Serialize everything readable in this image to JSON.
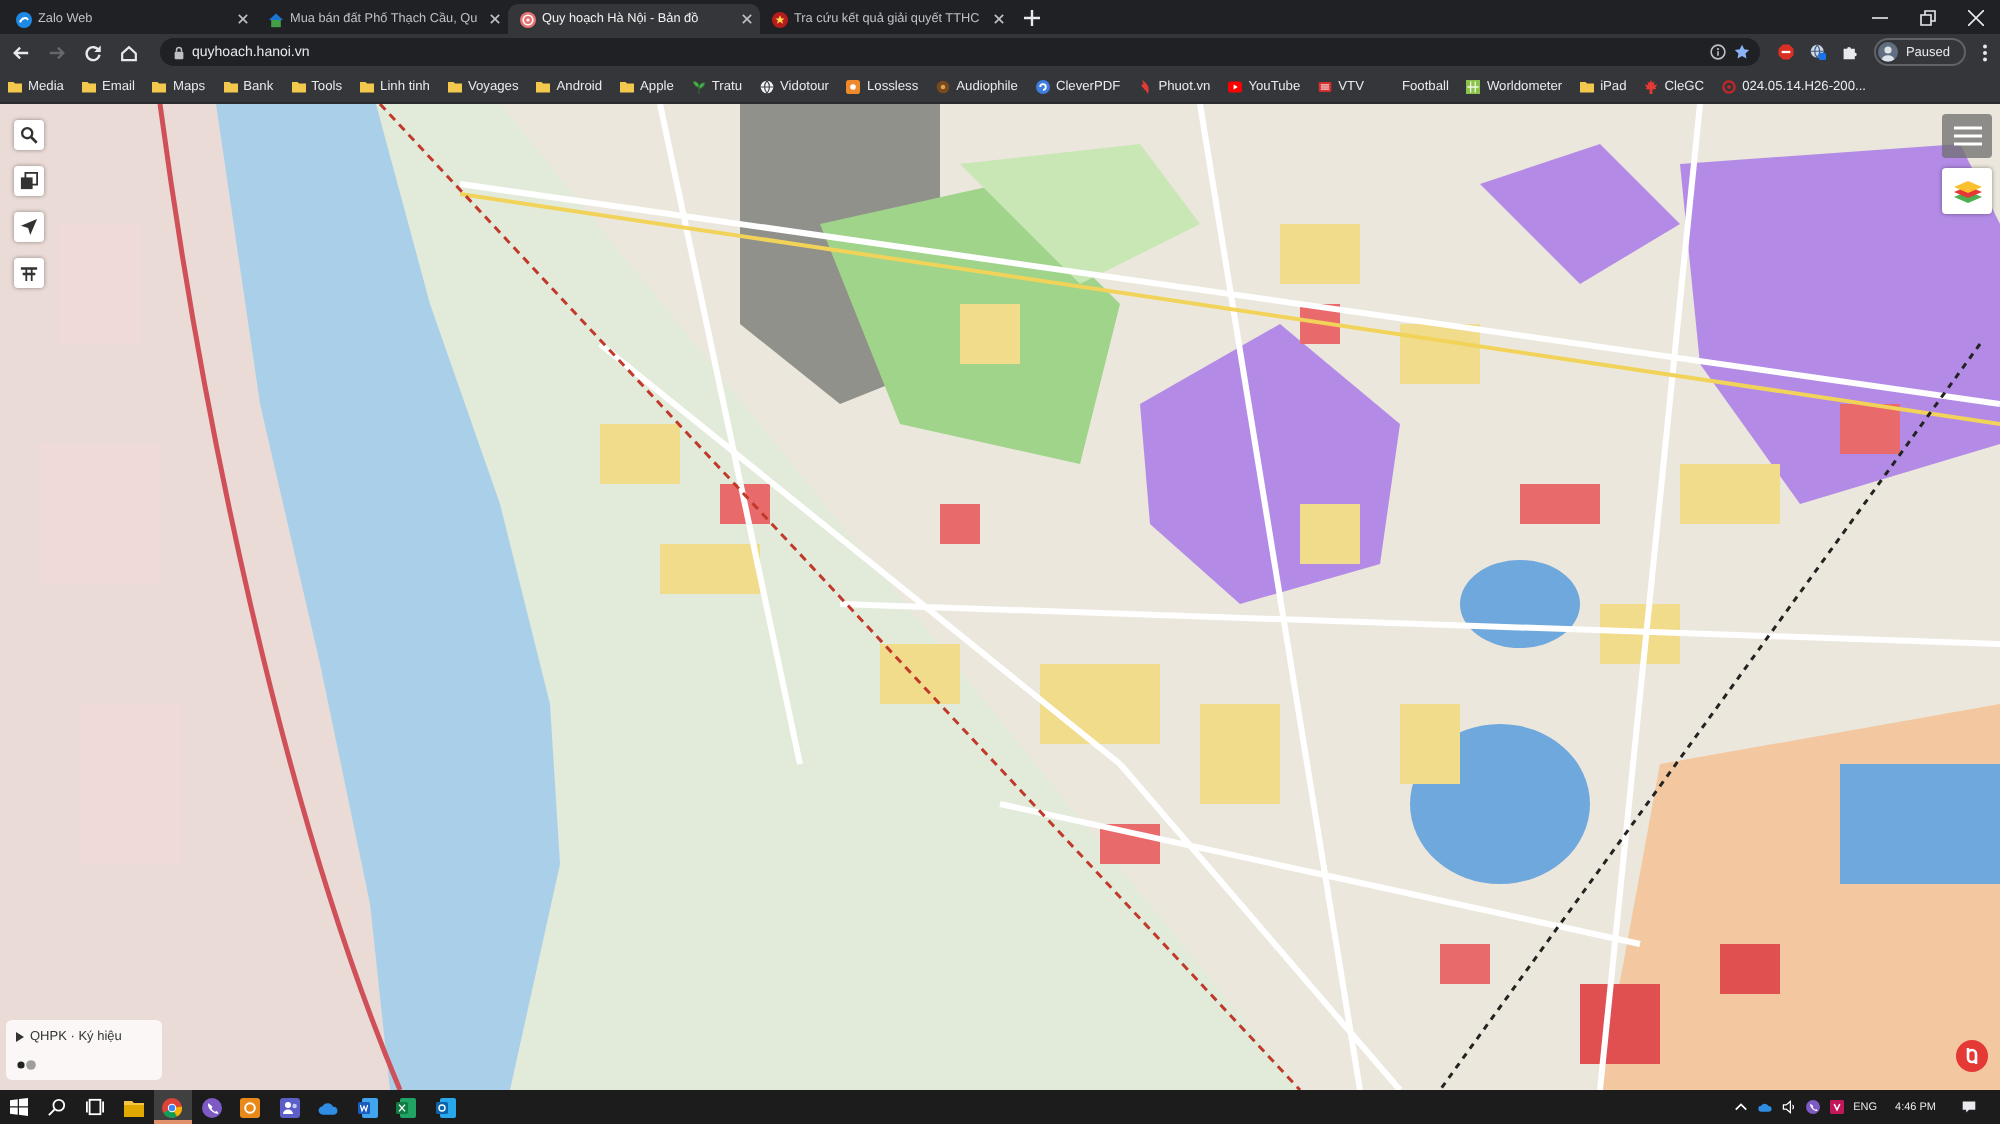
{
  "tabs": [
    {
      "title": "Zalo Web",
      "kind": "bubble",
      "selected": false
    },
    {
      "title": "Mua bán đất Phố Thạch Cầu, Qu",
      "kind": "house",
      "selected": false
    },
    {
      "title": "Quy hoạch Hà Nội - Bản đồ",
      "kind": "emblem",
      "selected": true
    },
    {
      "title": "Tra cứu kết quả giải quyết TTHC",
      "kind": "seal",
      "selected": false
    }
  ],
  "toolbar": {
    "forward": {
      "disabled": true
    },
    "url": "quyhoach.hanoi.vn",
    "profile": {
      "label": "Paused"
    }
  },
  "bookmarks": [
    {
      "label": "Media",
      "kind": "folder"
    },
    {
      "label": "Email",
      "kind": "folder"
    },
    {
      "label": "Maps",
      "kind": "folder"
    },
    {
      "label": "Bank",
      "kind": "folder"
    },
    {
      "label": "Tools",
      "kind": "folder"
    },
    {
      "label": "Linh tinh",
      "kind": "folder"
    },
    {
      "label": "Voyages",
      "kind": "folder"
    },
    {
      "label": "Android",
      "kind": "folder"
    },
    {
      "label": "Apple",
      "kind": "folder"
    },
    {
      "label": "Tratu",
      "kind": "plant"
    },
    {
      "label": "Vidotour",
      "kind": "globe"
    },
    {
      "label": "Lossless",
      "kind": "tile"
    },
    {
      "label": "Audiophile",
      "kind": "dot"
    },
    {
      "label": "CleverPDF",
      "kind": "swirl"
    },
    {
      "label": "Phuot.vn",
      "kind": "flame"
    },
    {
      "label": "YouTube",
      "kind": "play"
    },
    {
      "label": "VTV",
      "kind": "badge"
    },
    {
      "label": "Football",
      "kind": "blank"
    },
    {
      "label": "Worldometer",
      "kind": "grid"
    },
    {
      "label": "iPad",
      "kind": "folder"
    },
    {
      "label": "CleGC",
      "kind": "maple"
    },
    {
      "label": "024.05.14.H26-200...",
      "kind": "ring"
    }
  ],
  "map": {
    "legend": {
      "title": "QHPK · Ký hiệu"
    }
  },
  "taskbar": {
    "apps": [
      {
        "kind": "folder",
        "selected": false
      },
      {
        "kind": "browser",
        "selected": true
      },
      {
        "kind": "phone",
        "selected": false
      },
      {
        "kind": "tile",
        "selected": false
      },
      {
        "kind": "team",
        "selected": false
      },
      {
        "kind": "cloud",
        "selected": false
      },
      {
        "kind": "word",
        "selected": false
      },
      {
        "kind": "sheet",
        "selected": false
      },
      {
        "kind": "mail",
        "selected": false
      }
    ],
    "language": "ENG",
    "time": "4:46 PM"
  }
}
